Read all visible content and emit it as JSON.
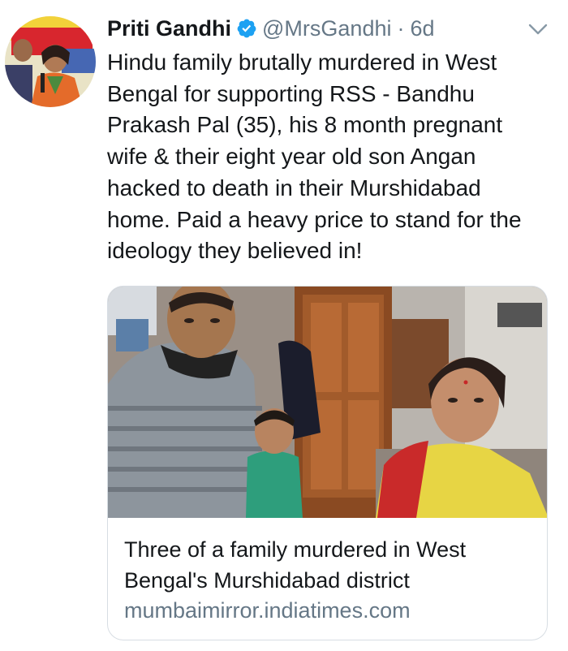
{
  "tweet": {
    "author_name": "Priti Gandhi",
    "handle": "@MrsGandhi",
    "separator": "·",
    "time": "6d",
    "text_lines": [
      "Hindu family brutally murdered in West",
      "Bengal for supporting RSS - Bandhu",
      "Prakash Pal (35), his 8 month pregnant",
      "wife & their eight year old son Angan",
      "hacked to death in their Murshidabad",
      "home. Paid a heavy price to stand for the",
      "ideology they believed in!"
    ]
  },
  "card": {
    "title_lines": [
      "Three of a family murdered in West",
      "Bengal's Murshidabad district"
    ],
    "domain": "mumbaimirror.indiatimes.com"
  },
  "icons": {
    "verified": "verified-badge-icon",
    "menu": "chevron-down-icon"
  },
  "colors": {
    "verified_blue": "#1da1f2",
    "secondary_text": "#657786",
    "primary_text": "#14171a",
    "card_border": "#d7dde3"
  }
}
